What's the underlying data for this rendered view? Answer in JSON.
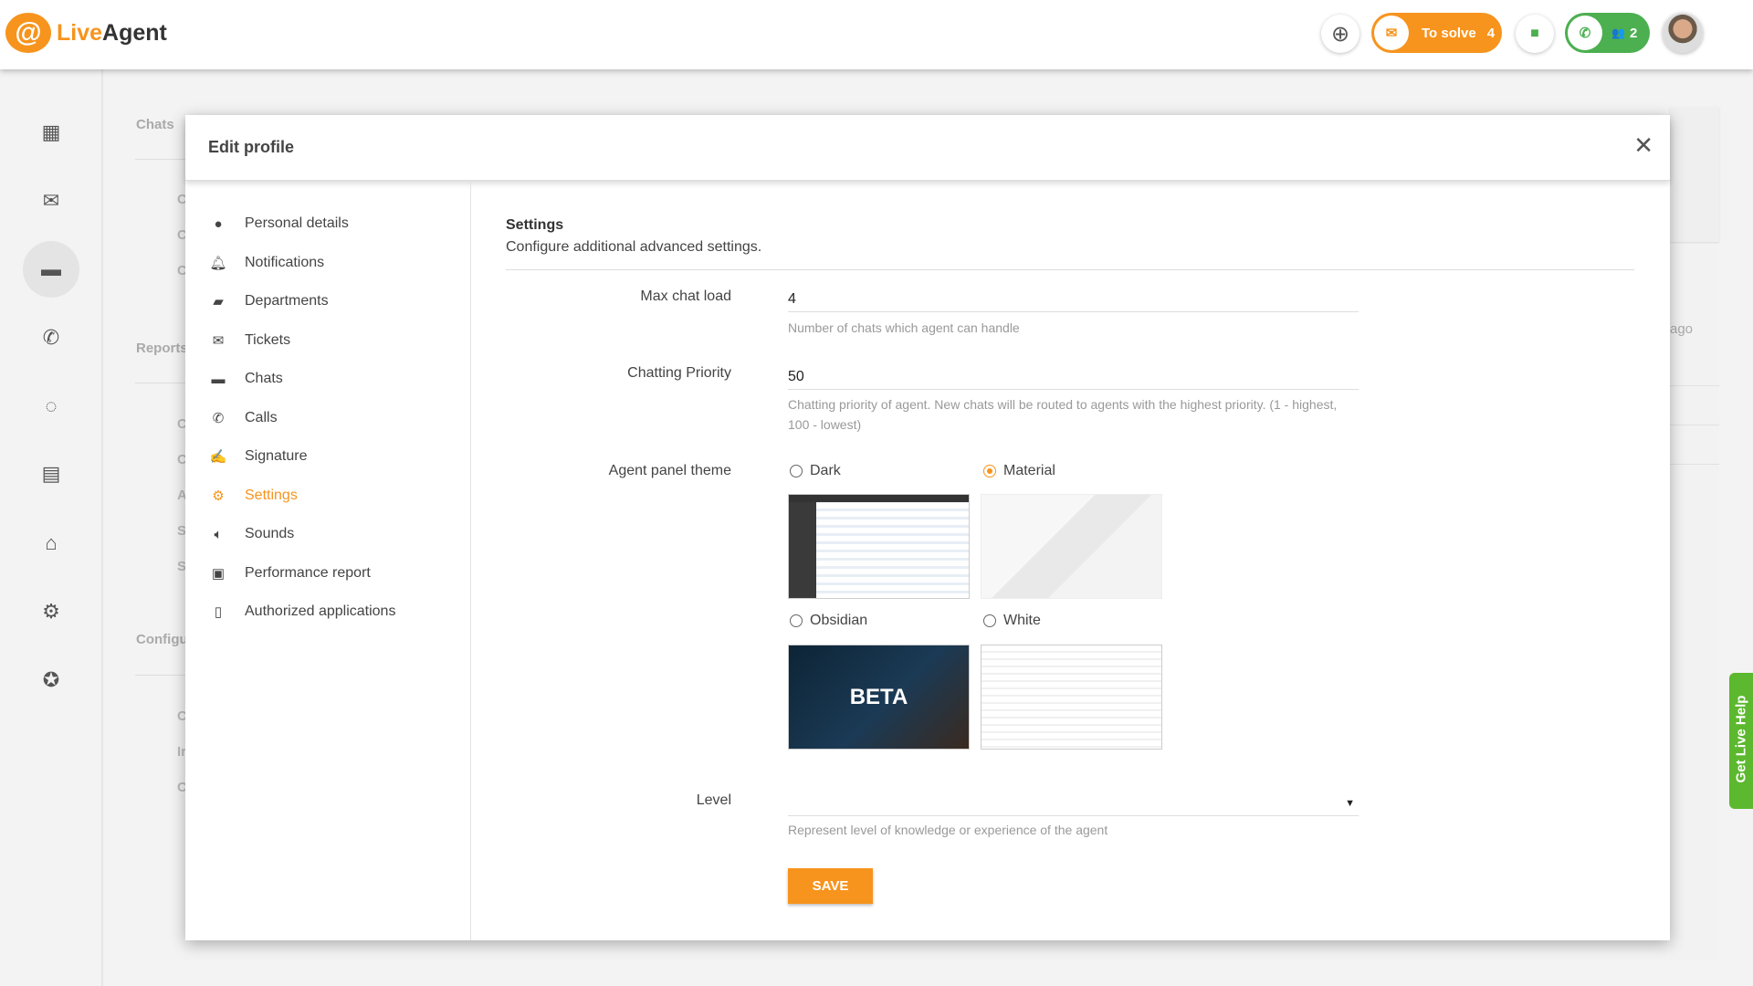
{
  "app": {
    "logo_mark": "@",
    "logo_live": "Live",
    "logo_agent": "Agent"
  },
  "header": {
    "to_solve_label": "To solve",
    "to_solve_count": "4",
    "online_count": "2",
    "brand_color": "#f7941d",
    "online_color": "#4caf50"
  },
  "background": {
    "sections": [
      "Chats",
      "Reports",
      "Configu"
    ],
    "row_letters": [
      "C",
      "C",
      "C",
      "C",
      "C",
      "A",
      "S",
      "S",
      "C",
      "Ir",
      "C"
    ],
    "time_fragment": "ago"
  },
  "modal": {
    "title": "Edit profile",
    "menu": [
      {
        "label": "Personal details",
        "icon": "person-icon"
      },
      {
        "label": "Notifications",
        "icon": "bell-icon"
      },
      {
        "label": "Departments",
        "icon": "folder-icon"
      },
      {
        "label": "Tickets",
        "icon": "envelope-icon"
      },
      {
        "label": "Chats",
        "icon": "chat-icon"
      },
      {
        "label": "Calls",
        "icon": "phone-icon"
      },
      {
        "label": "Signature",
        "icon": "signature-icon"
      },
      {
        "label": "Settings",
        "icon": "gear-icon",
        "active": true
      },
      {
        "label": "Sounds",
        "icon": "speaker-icon"
      },
      {
        "label": "Performance report",
        "icon": "chip-icon"
      },
      {
        "label": "Authorized applications",
        "icon": "tablet-icon"
      }
    ],
    "section_title": "Settings",
    "section_desc": "Configure additional advanced settings.",
    "max_chat_load": {
      "label": "Max chat load",
      "value": "4",
      "help": "Number of chats which agent can handle"
    },
    "chatting_priority": {
      "label": "Chatting Priority",
      "value": "50",
      "help": "Chatting priority of agent. New chats will be routed to agents with the highest priority. (1 - highest, 100 - lowest)"
    },
    "theme": {
      "label": "Agent panel theme",
      "options": [
        {
          "label": "Dark",
          "selected": false
        },
        {
          "label": "Material",
          "selected": true
        },
        {
          "label": "Obsidian",
          "selected": false,
          "badge": "BETA"
        },
        {
          "label": "White",
          "selected": false
        }
      ]
    },
    "level": {
      "label": "Level",
      "value": "",
      "help": "Represent level of knowledge or experience of the agent"
    },
    "save_label": "SAVE"
  },
  "live_help": "Get Live Help"
}
